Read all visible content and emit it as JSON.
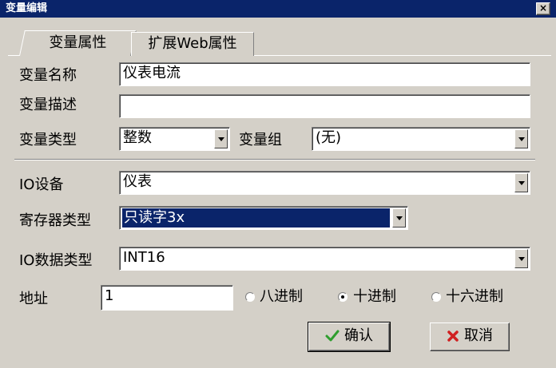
{
  "window": {
    "title": "变量编辑",
    "close_label": "×"
  },
  "tabs": [
    {
      "label": "变量属性",
      "active": true
    },
    {
      "label": "扩展Web属性",
      "active": false
    }
  ],
  "form": {
    "var_name": {
      "label": "变量名称",
      "value": "仪表电流"
    },
    "var_desc": {
      "label": "变量描述",
      "value": ""
    },
    "var_type": {
      "label": "变量类型",
      "value": "整数"
    },
    "var_group": {
      "label": "变量组",
      "value": "(无)"
    },
    "io_device": {
      "label": "IO设备",
      "value": "仪表"
    },
    "register_type": {
      "label": "寄存器类型",
      "value": "只读字3x"
    },
    "io_data_type": {
      "label": "IO数据类型",
      "value": "INT16"
    },
    "address": {
      "label": "地址",
      "value": "1"
    },
    "radix": {
      "options": [
        "八进制",
        "十进制",
        "十六进制"
      ],
      "selected": "十进制"
    }
  },
  "buttons": {
    "ok": "确认",
    "cancel": "取消"
  },
  "colors": {
    "titlebar": "#0a246a",
    "face": "#d4d0c8",
    "ok_icon": "#2e9e2e",
    "cancel_icon": "#d02020"
  }
}
